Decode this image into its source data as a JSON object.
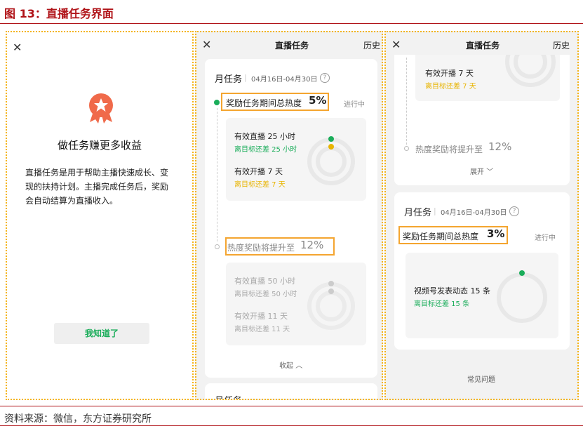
{
  "figure_title": "图 13：直播任务界面",
  "source": "资料来源：微信，东方证券研究所",
  "panel1": {
    "heading": "做任务赚更多收益",
    "desc_lines": [
      "直播任务是用于帮助主播快速成长、变",
      "现的扶持计划。主播完成任务后，奖励",
      "会自动结算为直播收入。"
    ],
    "ok_button": "我知道了"
  },
  "panel2": {
    "header_title": "直播任务",
    "history": "历史",
    "month_label": "月任务",
    "date_range": "04月16日-04月30日",
    "task_title": "奖励任务期间总热度",
    "task_pct": "5%",
    "status": "进行中",
    "item1_label": "有效直播 25 小时",
    "item1_remain": "离目标还差 25 小时",
    "item2_label": "有效开播 7 天",
    "item2_remain": "离目标还差 7 天",
    "boost_text": "热度奖励将提升至",
    "boost_pct": "12%",
    "item3_label": "有效直播 50 小时",
    "item3_remain": "离目标还差 50 小时",
    "item4_label": "有效开播 11 天",
    "item4_remain": "离目标还差 11 天",
    "collapse": "收起",
    "next_month_partial": "月任务"
  },
  "panel3": {
    "header_title": "直播任务",
    "history": "历史",
    "item_label": "有效开播 7 天",
    "item_remain": "离目标还差 7 天",
    "boost_text": "热度奖励将提升至",
    "boost_pct": "12%",
    "expand": "展开",
    "month_label": "月任务",
    "date_range": "04月16日-04月30日",
    "task_title": "奖励任务期间总热度",
    "task_pct": "3%",
    "status": "进行中",
    "video_label": "视频号发表动态 15 条",
    "video_remain": "离目标还差 15 条",
    "faq": "常见问题"
  },
  "colors": {
    "accent_red": "#b01318",
    "highlight": "#f4a530",
    "green": "#1aad5a",
    "yellow": "#e8b400"
  },
  "icons": [
    "close-icon",
    "medal-icon",
    "help-icon",
    "chevron-up-icon",
    "chevron-down-icon"
  ]
}
